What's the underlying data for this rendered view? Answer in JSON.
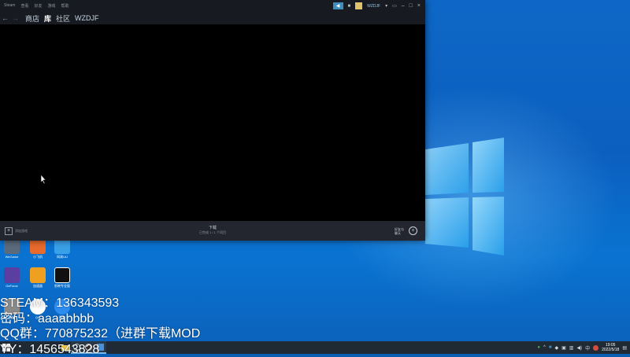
{
  "steam": {
    "title_menu": [
      "Steam",
      "查看",
      "好友",
      "游戏",
      "帮助"
    ],
    "username": "WZDJF",
    "nav": {
      "store": "商店",
      "library": "库",
      "community": "社区",
      "profile": "WZDJF"
    },
    "bottom": {
      "add_game": "添加游戏",
      "downloads_title": "下载",
      "downloads_sub": "已完成 1 / 1 个项目",
      "friends_chat": "好友与聊天"
    }
  },
  "desktop_icons": [
    {
      "label": "WeGame",
      "color": "#5a6b7c"
    },
    {
      "label": "小飞机",
      "color": "#e86a2c"
    },
    {
      "label": "网易UU",
      "color": "#3aa0e8"
    },
    {
      "label": "GeForce",
      "color": "#5b3fa0"
    },
    {
      "label": "加速器",
      "color": "#f0a020"
    },
    {
      "label": "剪映专业版",
      "color": "#111111"
    },
    {
      "label": "鼠标",
      "color": "#8a8a8a"
    },
    {
      "label": "QQ",
      "color": "#ffffff"
    },
    {
      "label": "酷狗",
      "color": "#2d8cf0"
    }
  ],
  "overlay": {
    "steam_line": "STEAM：136343593",
    "password_line": "密码：aaaabbbb",
    "qq_line": "QQ群：770875232（进群下载MOD",
    "yy_line": "YY：1456543828"
  },
  "taskbar": {
    "time": "19:05",
    "date": "2022/5/18"
  },
  "colors": {
    "steam_dark": "#171a21",
    "steam_bottom": "#23262e",
    "accent": "#3d8ebf",
    "taskbar": "#1f2a35"
  }
}
